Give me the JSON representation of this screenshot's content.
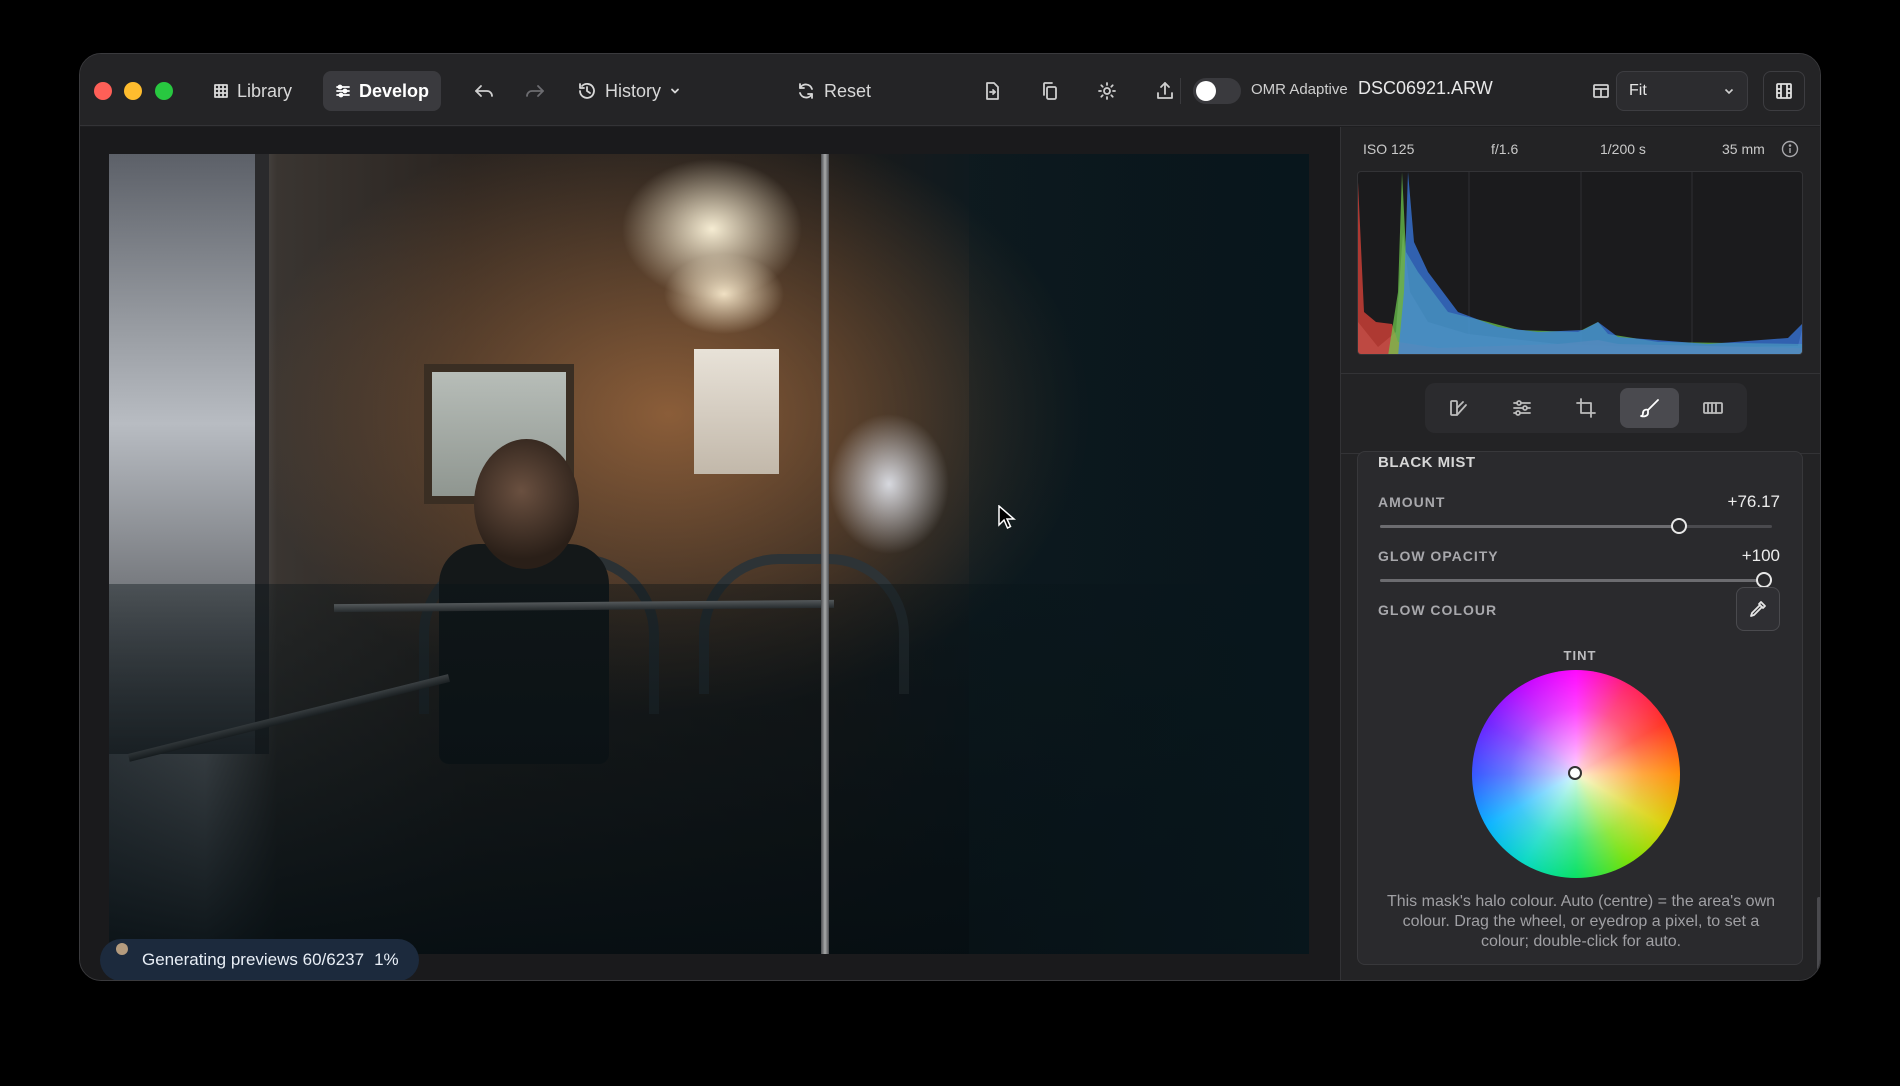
{
  "toolbar": {
    "library_label": "Library",
    "develop_label": "Develop",
    "history_label": "History",
    "reset_label": "Reset",
    "omr_label": "OMR Adaptive",
    "file_name": "DSC06921.ARW",
    "zoom_select": "Fit"
  },
  "canvas": {
    "progress_text": "Generating previews 60/6237",
    "progress_percent": "1%"
  },
  "panel": {
    "exif": {
      "iso": "ISO 125",
      "aperture": "f/1.6",
      "shutter": "1/200 s",
      "focal": "35 mm"
    },
    "histogram": {
      "colors": {
        "red": "#e0443a",
        "green": "#6fcf4f",
        "blue": "#3a7ff0",
        "luma": "#9a9aa0"
      }
    },
    "tools": [
      "presets-icon",
      "adjust-sliders-icon",
      "crop-icon",
      "brush-icon",
      "film-frame-icon"
    ],
    "section": {
      "title": "BLACK MIST",
      "amount_label": "AMOUNT",
      "amount_value": "+76.17",
      "amount_fraction": 0.7617,
      "glow_opacity_label": "GLOW OPACITY",
      "glow_opacity_value": "+100",
      "glow_opacity_fraction": 1.0,
      "glow_colour_label": "GLOW COLOUR",
      "tint_label": "TINT",
      "help_text": "This mask's halo colour. Auto (centre) = the area's own colour. Drag the wheel, or eyedrop a pixel, to set a colour; double-click for auto."
    }
  }
}
